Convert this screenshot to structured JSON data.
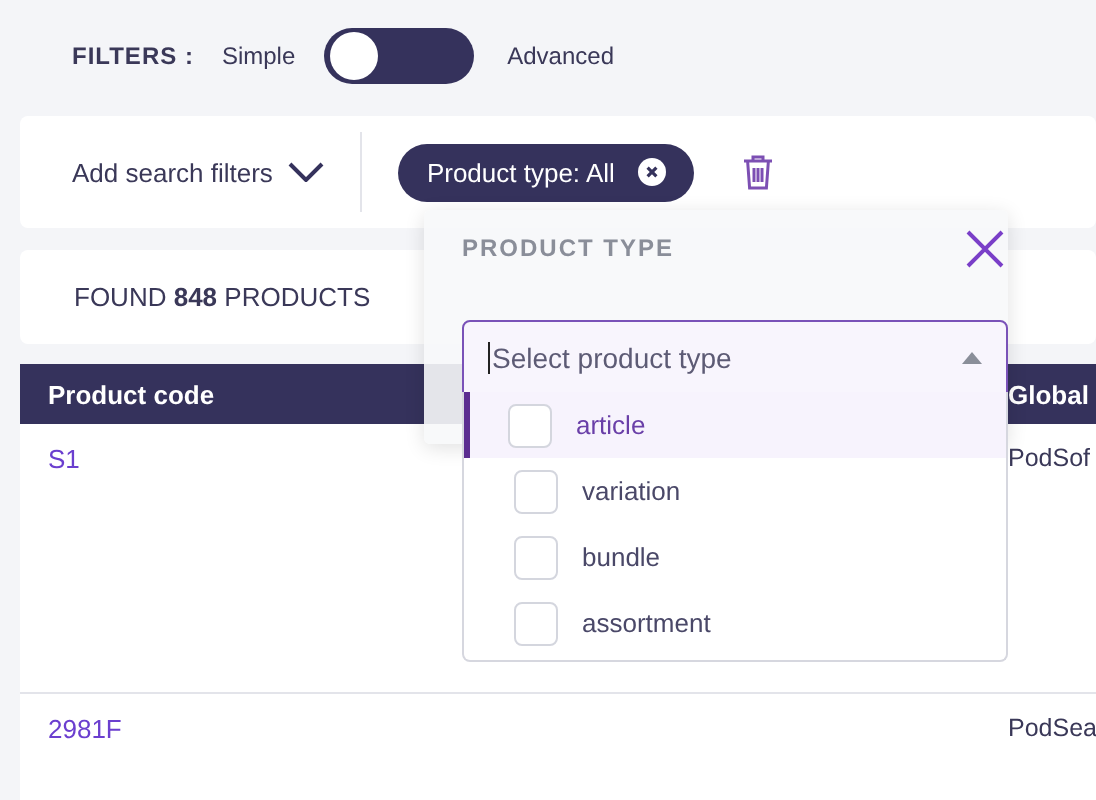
{
  "filters": {
    "label": "FILTERS :",
    "simple_label": "Simple",
    "advanced_label": "Advanced",
    "toggle": {
      "on": false
    }
  },
  "search_bar": {
    "add_filters": "Add search filters",
    "chip": {
      "label": "Product type:",
      "value": "All"
    }
  },
  "results": {
    "found_prefix": "FOUND",
    "count": "848",
    "found_suffix": "PRODUCTS"
  },
  "table": {
    "columns": [
      "Product code",
      "Global"
    ],
    "rows": [
      [
        "S1",
        "PodSof"
      ],
      [
        "2981F",
        "PodSea"
      ]
    ]
  },
  "popup": {
    "title": "PRODUCT TYPE",
    "select": {
      "placeholder": "Select product type",
      "expanded": true
    },
    "options": [
      {
        "label": "article",
        "selected": true,
        "checked": false
      },
      {
        "label": "variation",
        "selected": false,
        "checked": false
      },
      {
        "label": "bundle",
        "selected": false,
        "checked": false
      },
      {
        "label": "assortment",
        "selected": false,
        "checked": false
      }
    ]
  }
}
